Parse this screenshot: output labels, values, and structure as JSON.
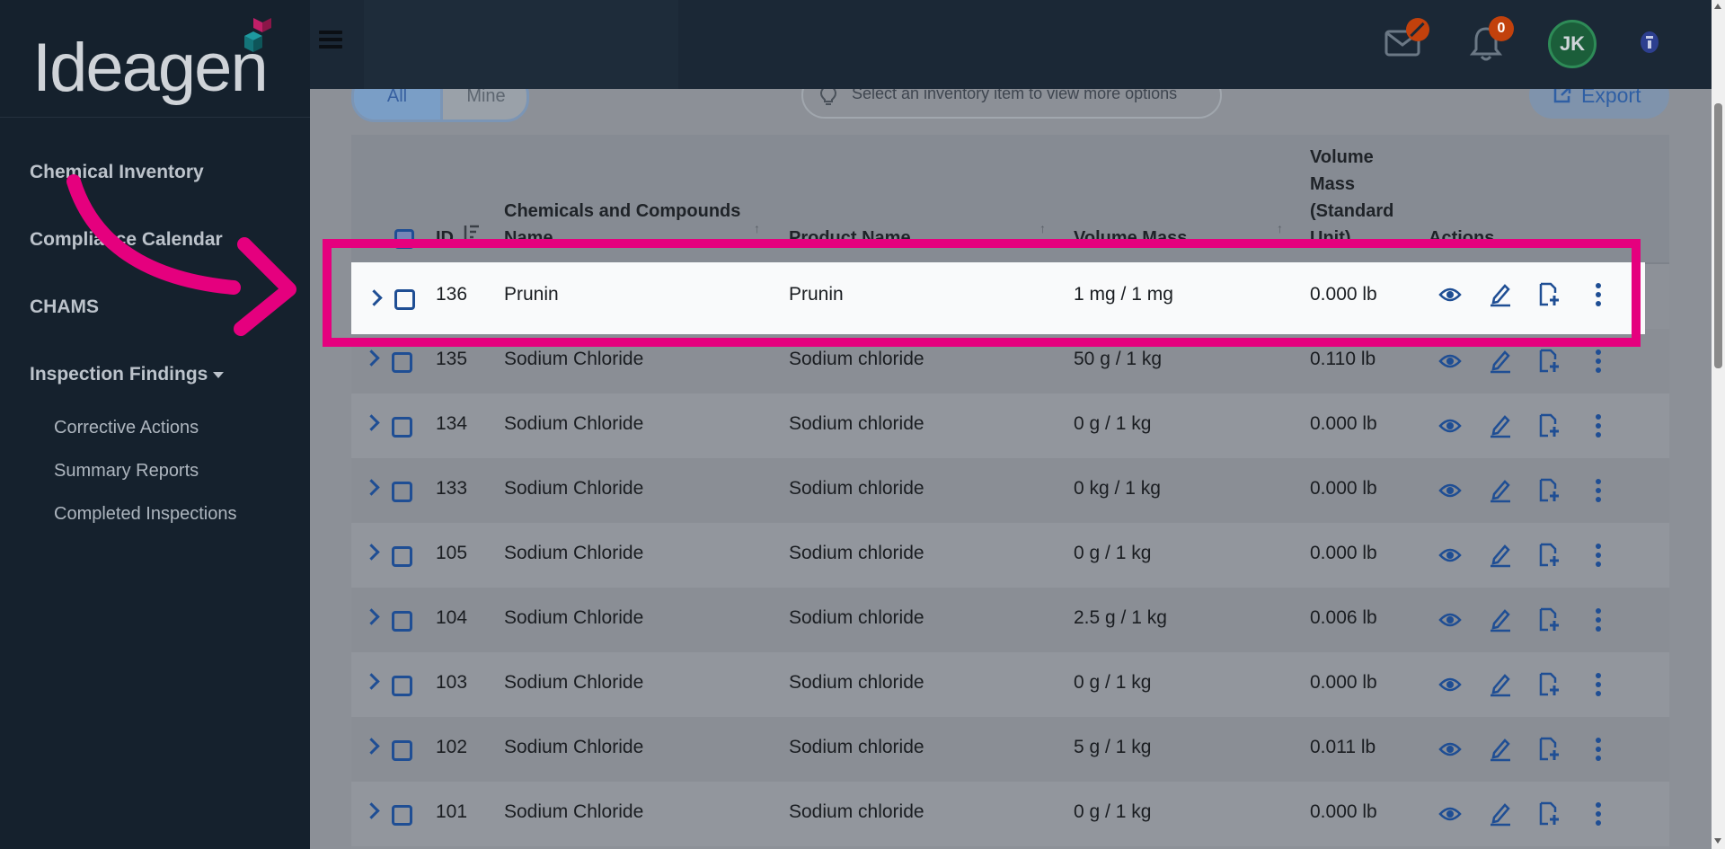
{
  "sidebar": {
    "logo_text": "Ideagen",
    "nav": [
      {
        "label": "Chemical Inventory"
      },
      {
        "label": "Compliance Calendar"
      },
      {
        "label": "CHAMS"
      },
      {
        "label": "Inspection Findings"
      }
    ],
    "sub": [
      {
        "label": "Corrective Actions"
      },
      {
        "label": "Summary Reports"
      },
      {
        "label": "Completed Inspections"
      }
    ]
  },
  "header": {
    "notification_count": "0",
    "avatar_initials": "JK",
    "icons": [
      "menu-icon",
      "mail-icon",
      "bell-icon",
      "help-icon"
    ]
  },
  "toolbar": {
    "filter_all": "All",
    "filter_mine": "Mine",
    "hint": "Select an inventory item to view more options",
    "export_label": "Export"
  },
  "table": {
    "columns": {
      "id": "ID",
      "chemicals": "Chemicals and Compounds Name",
      "product": "Product Name",
      "volume": "Volume Mass",
      "volume_std": "Volume Mass (Standard Unit)",
      "actions": "Actions"
    },
    "rows": [
      {
        "id": "136",
        "chemical": "Prunin",
        "product": "Prunin",
        "volume": "1 mg / 1 mg",
        "std": "0.000 lb"
      },
      {
        "id": "135",
        "chemical": "Sodium Chloride",
        "product": "Sodium chloride",
        "volume": "50 g / 1 kg",
        "std": "0.110 lb"
      },
      {
        "id": "134",
        "chemical": "Sodium Chloride",
        "product": "Sodium chloride",
        "volume": "0 g / 1 kg",
        "std": "0.000 lb"
      },
      {
        "id": "133",
        "chemical": "Sodium Chloride",
        "product": "Sodium chloride",
        "volume": "0 kg / 1 kg",
        "std": "0.000 lb"
      },
      {
        "id": "105",
        "chemical": "Sodium Chloride",
        "product": "Sodium chloride",
        "volume": "0 g / 1 kg",
        "std": "0.000 lb"
      },
      {
        "id": "104",
        "chemical": "Sodium Chloride",
        "product": "Sodium chloride",
        "volume": "2.5 g / 1 kg",
        "std": "0.006 lb"
      },
      {
        "id": "103",
        "chemical": "Sodium Chloride",
        "product": "Sodium chloride",
        "volume": "0 g / 1 kg",
        "std": "0.000 lb"
      },
      {
        "id": "102",
        "chemical": "Sodium Chloride",
        "product": "Sodium chloride",
        "volume": "5 g / 1 kg",
        "std": "0.011 lb"
      },
      {
        "id": "101",
        "chemical": "Sodium Chloride",
        "product": "Sodium chloride",
        "volume": "0 g / 1 kg",
        "std": "0.000 lb"
      }
    ]
  },
  "colors": {
    "highlight": "#e5007e",
    "sidebar_bg": "#15212d",
    "header_bg": "#1b2836",
    "action_blue": "#1f4e94",
    "badge": "#c2410c"
  }
}
